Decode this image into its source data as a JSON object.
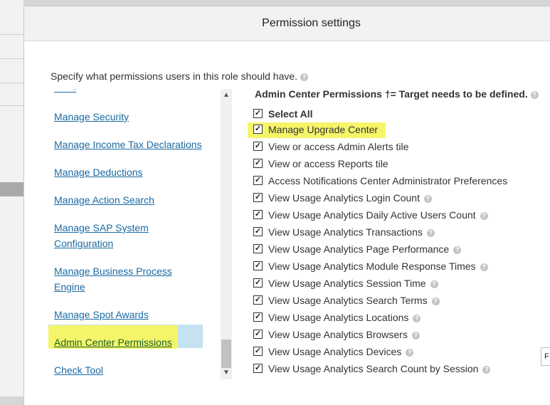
{
  "dialog": {
    "title": "Permission settings",
    "instructions": "Specify what permissions users in this role should have."
  },
  "categories": [
    {
      "label": "Manage Security"
    },
    {
      "label": "Manage Income Tax Declarations"
    },
    {
      "label": "Manage Deductions"
    },
    {
      "label": "Manage Action Search"
    },
    {
      "label": "Manage SAP System",
      "label2": "Configuration"
    },
    {
      "label": "Manage Business Process",
      "label2": "Engine"
    },
    {
      "label": "Manage Spot Awards"
    },
    {
      "label": "Admin Center Permissions",
      "selected": true
    },
    {
      "label": "Check Tool"
    }
  ],
  "permissions": {
    "header": "Admin Center Permissions †= Target needs to be defined.",
    "select_all": "Select All",
    "items": [
      {
        "label": "Manage Upgrade Center",
        "checked": true,
        "help": false
      },
      {
        "label": "View or access Admin Alerts tile",
        "checked": true,
        "help": false
      },
      {
        "label": "View or access Reports tile",
        "checked": true,
        "help": false
      },
      {
        "label": "Access Notifications Center Administrator Preferences",
        "checked": true,
        "help": false
      },
      {
        "label": "View Usage Analytics Login Count",
        "checked": true,
        "help": true
      },
      {
        "label": "View Usage Analytics Daily Active Users Count",
        "checked": true,
        "help": true
      },
      {
        "label": "View Usage Analytics Transactions",
        "checked": true,
        "help": true
      },
      {
        "label": "View Usage Analytics Page Performance",
        "checked": true,
        "help": true
      },
      {
        "label": "View Usage Analytics Module Response Times",
        "checked": true,
        "help": true
      },
      {
        "label": "View Usage Analytics Session Time",
        "checked": true,
        "help": true
      },
      {
        "label": "View Usage Analytics Search Terms",
        "checked": true,
        "help": true
      },
      {
        "label": "View Usage Analytics Locations",
        "checked": true,
        "help": true
      },
      {
        "label": "View Usage Analytics Browsers",
        "checked": true,
        "help": true
      },
      {
        "label": "View Usage Analytics Devices",
        "checked": true,
        "help": true
      },
      {
        "label": "View Usage Analytics Search Count by Session",
        "checked": true,
        "help": true
      }
    ]
  },
  "side_box_text": "F",
  "colors": {
    "link": "#1a6aa3",
    "highlight": "#f5f56a",
    "selected_row": "#c4e2ef"
  }
}
